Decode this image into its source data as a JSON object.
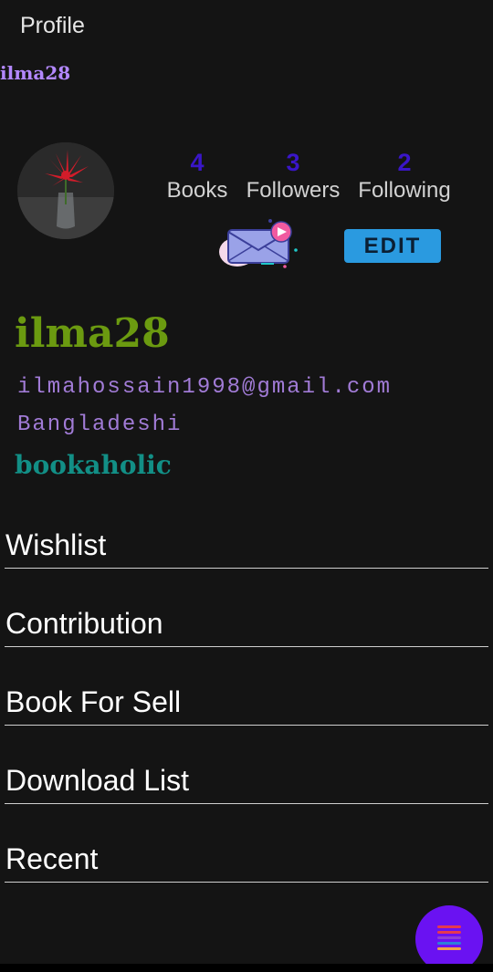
{
  "header": {
    "title": "Profile",
    "username": "ilma28"
  },
  "stats": [
    {
      "value": "4",
      "label": "Books"
    },
    {
      "value": "3",
      "label": "Followers"
    },
    {
      "value": "2",
      "label": "Following"
    }
  ],
  "actions": {
    "message_icon": "envelope-icon",
    "edit_label": "EDIT"
  },
  "profile": {
    "name": "ilma28",
    "email": "ilmahossain1998@gmail.com",
    "country": "Bangladeshi",
    "bio": "bookaholic"
  },
  "menu": [
    {
      "label": "Wishlist"
    },
    {
      "label": "Contribution"
    },
    {
      "label": "Book For Sell"
    },
    {
      "label": "Download List"
    },
    {
      "label": "Recent"
    }
  ],
  "fab": {
    "icon": "menu-lines-icon"
  },
  "colors": {
    "accent": "#6a12f2",
    "stat_number": "#3a16c8",
    "edit_button": "#2a9ae0",
    "name": "#6b9a10",
    "bio": "#128f86"
  }
}
